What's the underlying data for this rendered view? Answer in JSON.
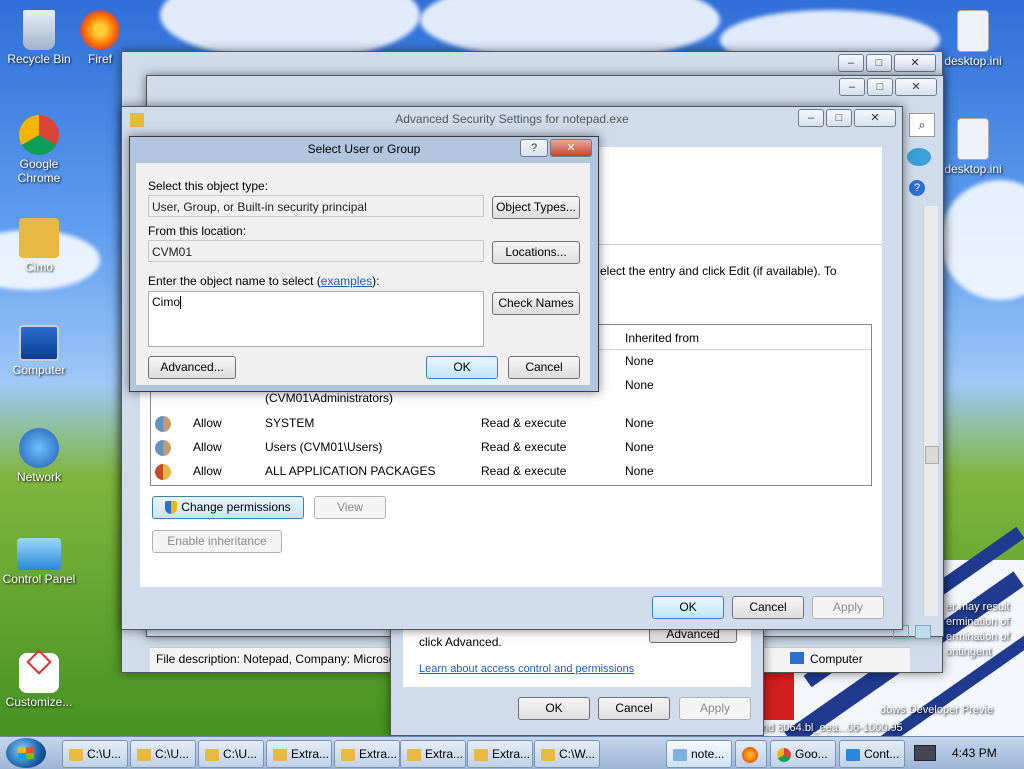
{
  "desktop": {
    "icons": [
      {
        "label": "Recycle Bin",
        "name": "recycle-bin-icon"
      },
      {
        "label": "Firef",
        "name": "firefox-icon"
      },
      {
        "label": "Google Chrome",
        "name": "chrome-icon"
      },
      {
        "label": "Cimo",
        "name": "user-folder-icon"
      },
      {
        "label": "Computer",
        "name": "computer-icon"
      },
      {
        "label": "Network",
        "name": "network-icon"
      },
      {
        "label": "Control Panel",
        "name": "control-panel-icon"
      },
      {
        "label": "Customize...",
        "name": "customize-icon"
      },
      {
        "label": "desktop.ini",
        "name": "file-icon"
      },
      {
        "label": "desktop.ini",
        "name": "file-icon-2"
      }
    ],
    "background_text": {
      "ending": "Read & execute",
      "side_note_lines": [
        "er may result",
        "ermination of",
        "ermination of",
        "ontingent"
      ],
      "bottom_lines": [
        "dows Developer Previe",
        "nd 8064.bl_eea...06-1000.95",
        "Computer"
      ]
    }
  },
  "file_window": {
    "description": "File description: Notepad, Company: Microso",
    "computer_label": "Computer"
  },
  "permissions_window": {
    "click_advanced": "click Advanced.",
    "learn_link": "Learn about access control and permissions",
    "advanced": "Advanced",
    "ok": "OK",
    "cancel": "Cancel",
    "apply": "Apply"
  },
  "adv_security": {
    "title": "Advanced Security Settings for notepad.exe",
    "instruction": "elect the entry and click Edit (if available). To",
    "header_inherited": "Inherited from",
    "rows": [
      {
        "type": "",
        "principal": "",
        "access": "",
        "inherited": "None"
      },
      {
        "type": "",
        "principal": "(CVM01\\Administrators)",
        "access": "",
        "inherited": "None"
      },
      {
        "type": "Allow",
        "principal": "SYSTEM",
        "access": "Read & execute",
        "inherited": "None"
      },
      {
        "type": "Allow",
        "principal": "Users (CVM01\\Users)",
        "access": "Read & execute",
        "inherited": "None"
      },
      {
        "type": "Allow",
        "principal": "ALL APPLICATION PACKAGES",
        "access": "Read & execute",
        "inherited": "None"
      }
    ],
    "change_permissions": "Change permissions",
    "view": "View",
    "enable_inheritance": "Enable inheritance",
    "ok": "OK",
    "cancel": "Cancel",
    "apply": "Apply"
  },
  "select_dialog": {
    "title": "Select User or Group",
    "help": "?",
    "object_type_label": "Select this object type:",
    "object_type_value": "User, Group, or Built-in security principal",
    "object_types_btn": "Object Types...",
    "location_label": "From this location:",
    "location_value": "CVM01",
    "locations_btn": "Locations...",
    "enter_label_prefix": "Enter the object name to select (",
    "examples_link": "examples",
    "enter_label_suffix": "):",
    "name_value": "Cimo",
    "check_names_btn": "Check Names",
    "advanced_btn": "Advanced...",
    "ok_btn": "OK",
    "cancel_btn": "Cancel"
  },
  "taskbar": {
    "items": [
      {
        "label": "C:\\U..."
      },
      {
        "label": "C:\\U..."
      },
      {
        "label": "C:\\U..."
      },
      {
        "label": "Extra..."
      },
      {
        "label": "Extra..."
      },
      {
        "label": "Extra..."
      },
      {
        "label": "Extra..."
      },
      {
        "label": "C:\\W..."
      },
      {
        "label": "note..."
      },
      {
        "label": ""
      },
      {
        "label": "Goo..."
      },
      {
        "label": "Cont..."
      }
    ],
    "clock": "4:43 PM"
  }
}
